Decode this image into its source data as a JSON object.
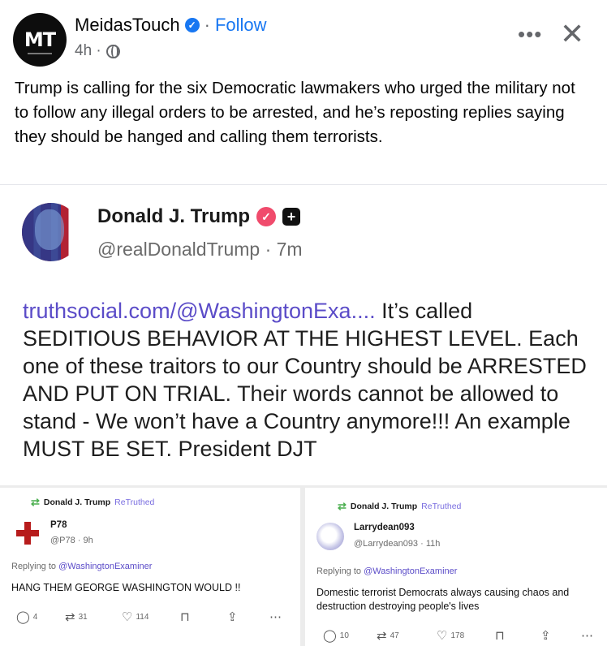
{
  "post": {
    "author": "MeidasTouch",
    "avatar_text": "MT",
    "separator": "·",
    "follow_label": "Follow",
    "time": "4h ·",
    "more_icon": "more-icon",
    "close_icon": "close-icon",
    "text": "Trump is calling for the six Democratic lawmakers who urged the military not to follow any illegal orders to be arrested, and he’s reposting replies saying they should be hanged and calling them terrorists."
  },
  "truth": {
    "name": "Donald J. Trump",
    "handle": "@realDonaldTrump · 7m",
    "link": "truthsocial.com/@WashingtonExa....",
    "body": " It’s called SEDITIOUS BEHAVIOR AT THE HIGHEST LEVEL. Each one of these traitors to our Country should be ARRESTED AND PUT ON TRIAL. Their words cannot be allowed to stand - We won’t have a Country anymore!!! An example MUST BE SET. President DJT"
  },
  "retruths": [
    {
      "retruther": "Donald J. Trump",
      "retruthed_label": "ReTruthed",
      "user": "P78",
      "handle": "@P78 · 9h",
      "replying_prefix": "Replying to",
      "replying_to": "@WashingtonExaminer",
      "text": "HANG THEM GEORGE WASHINGTON WOULD !!",
      "replies": "4",
      "retruths": "31",
      "likes": "114"
    },
    {
      "retruther": "Donald J. Trump",
      "retruthed_label": "ReTruthed",
      "user": "Larrydean093",
      "handle": "@Larrydean093 · 11h",
      "replying_prefix": "Replying to",
      "replying_to": "@WashingtonExaminer",
      "text": "Domestic terrorist Democrats always causing chaos and destruction destroying people's lives",
      "replies": "10",
      "retruths": "47",
      "likes": "178"
    }
  ]
}
